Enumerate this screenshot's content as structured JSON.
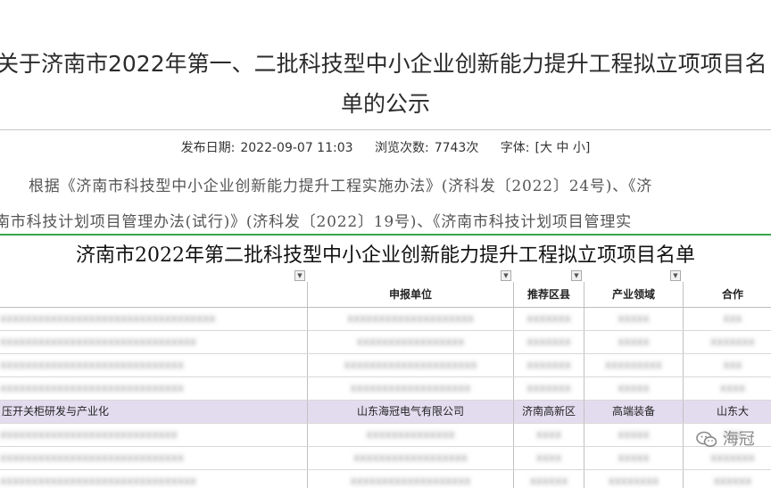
{
  "article": {
    "title_line1": "关于济南市2022年第一、二批科技型中小企业创新能力提升工程拟立项项目名",
    "title_line2": "单的公示",
    "publish_label": "发布日期:",
    "publish_date": "2022-09-07 11:03",
    "views_label": "浏览次数:",
    "views": "7743次",
    "font_label": "字体:",
    "font_options": "[大 中 小]",
    "para_line1": "根据《济南市科技型中小企业创新能力提升工程实施办法》(济科发〔2022〕24号)、《济",
    "para_line2": "南市科技计划项目管理办法(试行)》(济科发〔2022〕19号)、《济南市科技计划项目管理实"
  },
  "sheet": {
    "title": "济南市2022年第二批科技型中小企业创新能力提升工程拟立项项目名单",
    "headers": [
      "",
      "申报单位",
      "推荐区县",
      "产业领域",
      "合作"
    ],
    "highlight_row": [
      "压开关柜研发与产业化",
      "山东海冠电气有限公司",
      "济南高新区",
      "高端装备",
      "山东大"
    ]
  },
  "watermark": {
    "text": "海冠"
  },
  "colors": {
    "sheet_border": "#3aa64a",
    "highlight": "#e3dcef"
  }
}
